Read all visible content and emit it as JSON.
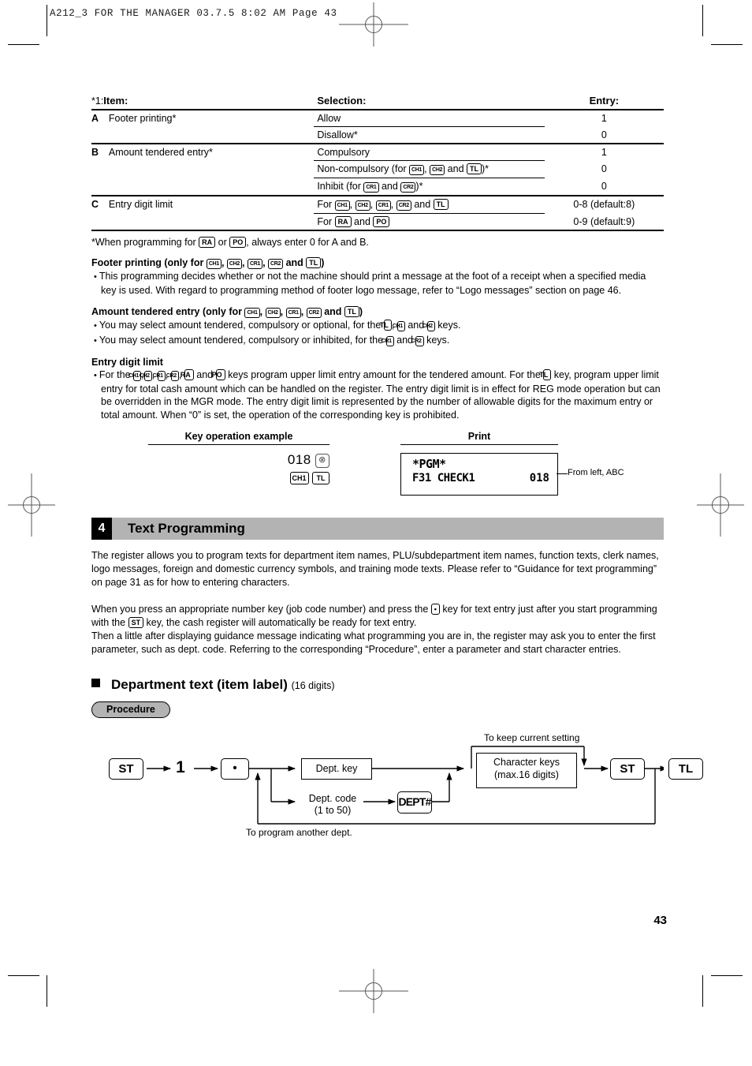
{
  "slug": "A212_3 FOR THE MANAGER   03.7.5 8:02 AM  Page 43",
  "page_number": "43",
  "spec_table": {
    "note_prefix": "*1:",
    "headers": {
      "item": "Item:",
      "selection": "Selection:",
      "entry": "Entry:"
    },
    "rows": [
      {
        "letter": "A",
        "item": "Footer printing*",
        "options": [
          {
            "selection_parts": [
              {
                "t": "text",
                "v": "Allow"
              }
            ],
            "entry": "1"
          },
          {
            "selection_parts": [
              {
                "t": "text",
                "v": "Disallow*"
              }
            ],
            "entry": "0"
          }
        ]
      },
      {
        "letter": "B",
        "item": "Amount tendered entry*",
        "options": [
          {
            "selection_parts": [
              {
                "t": "text",
                "v": "Compulsory"
              }
            ],
            "entry": "1"
          },
          {
            "selection_parts": [
              {
                "t": "text",
                "v": "Non-compulsory (for "
              },
              {
                "t": "key",
                "v": "CH1"
              },
              {
                "t": "text",
                "v": ", "
              },
              {
                "t": "key",
                "v": "CH2"
              },
              {
                "t": "text",
                "v": " and "
              },
              {
                "t": "key",
                "v": "TL"
              },
              {
                "t": "text",
                "v": ")*"
              }
            ],
            "entry": "0"
          },
          {
            "selection_parts": [
              {
                "t": "text",
                "v": "Inhibit (for "
              },
              {
                "t": "key",
                "v": "CR1"
              },
              {
                "t": "text",
                "v": " and "
              },
              {
                "t": "key",
                "v": "CR2"
              },
              {
                "t": "text",
                "v": ")*"
              }
            ],
            "entry": "0"
          }
        ]
      },
      {
        "letter": "C",
        "item": "Entry digit limit",
        "options": [
          {
            "selection_parts": [
              {
                "t": "text",
                "v": "For "
              },
              {
                "t": "key",
                "v": "CH1"
              },
              {
                "t": "text",
                "v": ", "
              },
              {
                "t": "key",
                "v": "CH2"
              },
              {
                "t": "text",
                "v": ", "
              },
              {
                "t": "key",
                "v": "CR1"
              },
              {
                "t": "text",
                "v": ", "
              },
              {
                "t": "key",
                "v": "CR2"
              },
              {
                "t": "text",
                "v": " and "
              },
              {
                "t": "key",
                "v": "TL"
              }
            ],
            "entry": "0-8 (default:8)"
          },
          {
            "selection_parts": [
              {
                "t": "text",
                "v": "For "
              },
              {
                "t": "key",
                "v": "RA"
              },
              {
                "t": "text",
                "v": " and "
              },
              {
                "t": "key",
                "v": "PO"
              }
            ],
            "entry": "0-9 (default:9)"
          }
        ]
      }
    ],
    "footnote_parts": [
      {
        "t": "text",
        "v": "*When programming for "
      },
      {
        "t": "key",
        "v": "RA"
      },
      {
        "t": "text",
        "v": " or "
      },
      {
        "t": "key",
        "v": "PO"
      },
      {
        "t": "text",
        "v": ", always enter 0 for A and B."
      }
    ]
  },
  "sections": [
    {
      "heading_parts": [
        {
          "t": "text",
          "v": "Footer printing (only for "
        },
        {
          "t": "key",
          "v": "CH1"
        },
        {
          "t": "text",
          "v": ", "
        },
        {
          "t": "key",
          "v": "CH2"
        },
        {
          "t": "text",
          "v": ", "
        },
        {
          "t": "key",
          "v": "CR1"
        },
        {
          "t": "text",
          "v": ", "
        },
        {
          "t": "key",
          "v": "CR2"
        },
        {
          "t": "text",
          "v": " and "
        },
        {
          "t": "key",
          "v": "TL"
        },
        {
          "t": "text",
          "v": ")"
        }
      ],
      "bullets": [
        [
          {
            "t": "text",
            "v": "This programming decides whether or not the machine should print a message at the foot of a receipt when a specified media key is used.  With regard to programming method of footer logo message, refer to “Logo messages” section on page 46."
          }
        ]
      ]
    },
    {
      "heading_parts": [
        {
          "t": "text",
          "v": "Amount tendered entry (only for "
        },
        {
          "t": "key",
          "v": "CH1"
        },
        {
          "t": "text",
          "v": ", "
        },
        {
          "t": "key",
          "v": "CH2"
        },
        {
          "t": "text",
          "v": ", "
        },
        {
          "t": "key",
          "v": "CR1"
        },
        {
          "t": "text",
          "v": ", "
        },
        {
          "t": "key",
          "v": "CR2"
        },
        {
          "t": "text",
          "v": " and "
        },
        {
          "t": "key",
          "v": "TL"
        },
        {
          "t": "text",
          "v": ")"
        }
      ],
      "bullets": [
        [
          {
            "t": "text",
            "v": "You may select amount tendered, compulsory or optional, for the "
          },
          {
            "t": "key",
            "v": "TL"
          },
          {
            "t": "text",
            "v": ", "
          },
          {
            "t": "key",
            "v": "CH1"
          },
          {
            "t": "text",
            "v": " and "
          },
          {
            "t": "key",
            "v": "CH2"
          },
          {
            "t": "text",
            "v": " keys."
          }
        ],
        [
          {
            "t": "text",
            "v": "You may select amount tendered, compulsory or inhibited, for the "
          },
          {
            "t": "key",
            "v": "CR1"
          },
          {
            "t": "text",
            "v": " and "
          },
          {
            "t": "key",
            "v": "CR2"
          },
          {
            "t": "text",
            "v": " keys."
          }
        ]
      ]
    },
    {
      "heading_parts": [
        {
          "t": "text",
          "v": "Entry digit limit"
        }
      ],
      "bullets": [
        [
          {
            "t": "text",
            "v": "For the "
          },
          {
            "t": "key",
            "v": "CH1"
          },
          {
            "t": "text",
            "v": ","
          },
          {
            "t": "key",
            "v": "CH2"
          },
          {
            "t": "text",
            "v": ", "
          },
          {
            "t": "key",
            "v": "CR1"
          },
          {
            "t": "text",
            "v": ", "
          },
          {
            "t": "key",
            "v": "CR2"
          },
          {
            "t": "text",
            "v": ", "
          },
          {
            "t": "key",
            "v": "RA"
          },
          {
            "t": "text",
            "v": " and "
          },
          {
            "t": "key",
            "v": "PO"
          },
          {
            "t": "text",
            "v": " keys program upper limit entry amount for the tendered amount.  For the "
          },
          {
            "t": "key",
            "v": "TL"
          },
          {
            "t": "text",
            "v": " key, program upper limit entry for total cash amount which can be handled on the register.  The entry digit limit is in effect for REG mode operation but can be overridden in the MGR mode.  The entry digit limit is represented by the number of allowable digits for the maximum entry or total amount.  When “0” is set, the operation of the corresponding key is prohibited."
          }
        ]
      ]
    }
  ],
  "example": {
    "key_op_heading": "Key operation example",
    "print_heading": "Print",
    "keys_line1_number": "018",
    "keys_line1_icon": "multiply-key",
    "keys_line2": [
      "CH1",
      "TL"
    ],
    "receipt": {
      "line1": "*PGM*",
      "line2_left": "F31 CHECK1",
      "line2_right": "018"
    },
    "annotation": "From left, ABC"
  },
  "text_programming": {
    "number": "4",
    "title": "Text Programming",
    "intro": "The register allows you to program texts for department item names, PLU/subdepartment item names, function texts, clerk names, logo messages, foreign and domestic currency symbols, and training mode texts.  Please refer to “Guidance for text programming” on page 31 as for how to entering characters.",
    "body_parts": [
      {
        "t": "text",
        "v": "When you press an appropriate number key (job code number) and press the "
      },
      {
        "t": "key",
        "v": "•"
      },
      {
        "t": "text",
        "v": " key for text entry just after you start programming with the "
      },
      {
        "t": "key",
        "v": "ST"
      },
      {
        "t": "text",
        "v": " key, the cash register will automatically be ready for text entry."
      }
    ],
    "body_parts2": [
      {
        "t": "text",
        "v": "Then a little after displaying guidance message indicating what programming you are in, the register may ask you to enter the first parameter, such as dept. code.  Referring to the corresponding “Procedure”, enter a parameter and start character entries."
      }
    ]
  },
  "dept_text": {
    "heading_main": "Department text (item label)",
    "heading_suffix": "(16 digits)",
    "procedure_label": "Procedure",
    "flow": {
      "n_st1": "ST",
      "n_one": "1",
      "n_dot": "•",
      "n_dept_key": "Dept. key",
      "n_dept_code_l1": "Dept. code",
      "n_dept_code_l2": "(1 to 50)",
      "n_deptnum": "DEPT#",
      "n_char_l1": "Character keys",
      "n_char_l2": "(max.16 digits)",
      "n_st2": "ST",
      "n_tl": "TL",
      "lbl_keep": "To keep current setting",
      "lbl_another": "To program another dept."
    }
  }
}
